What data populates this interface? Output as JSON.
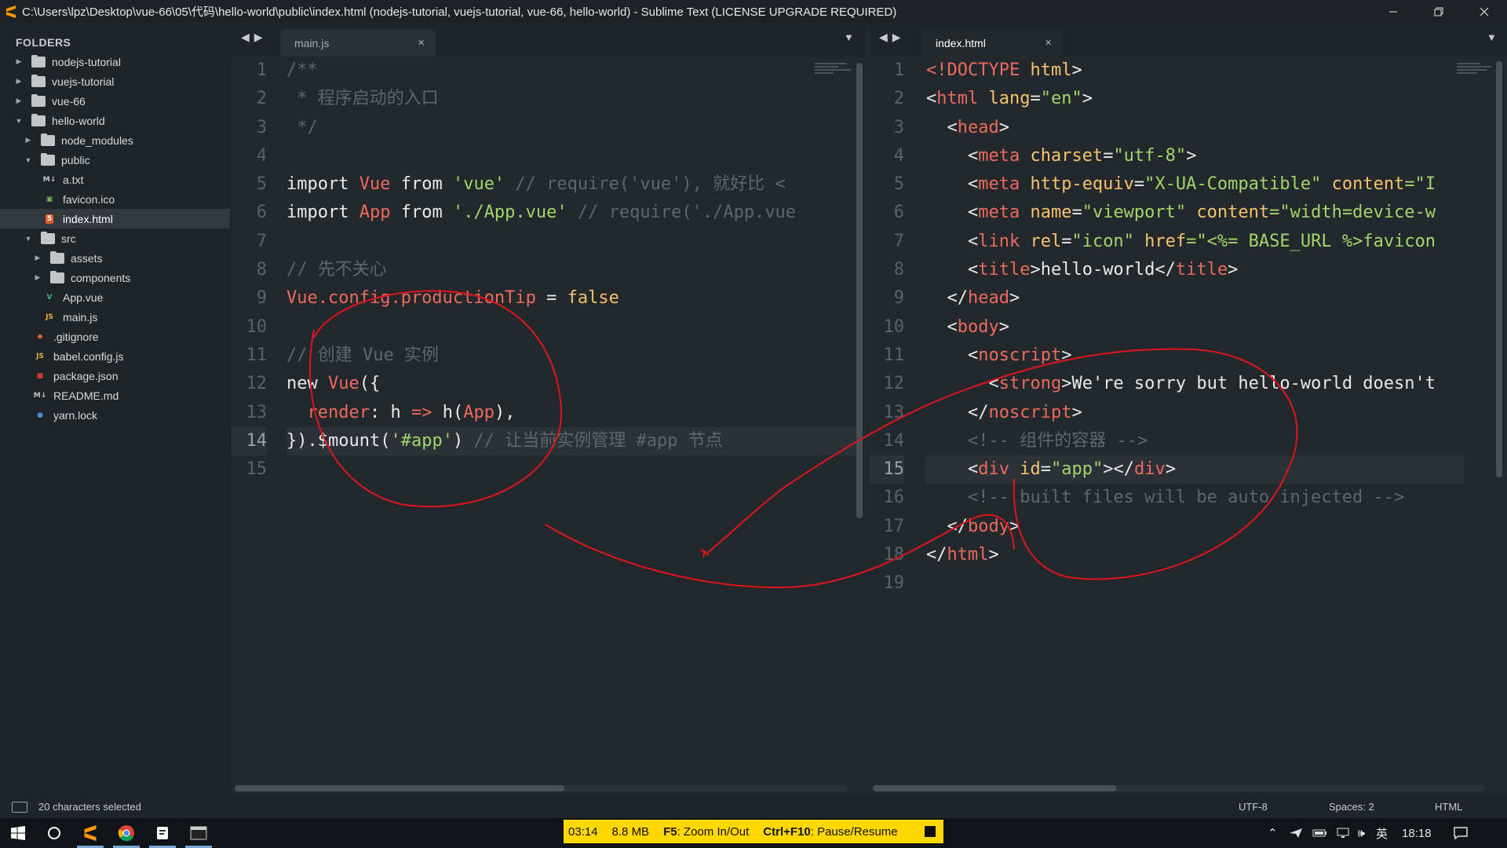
{
  "window": {
    "title": "C:\\Users\\lpz\\Desktop\\vue-66\\05\\代码\\hello-world\\public\\index.html (nodejs-tutorial, vuejs-tutorial, vue-66, hello-world) - Sublime Text (LICENSE UPGRADE REQUIRED)",
    "app_icon": "sublime-text-icon"
  },
  "sidebar": {
    "header": "FOLDERS",
    "items": [
      {
        "label": "nodejs-tutorial",
        "type": "folder",
        "expanded": false
      },
      {
        "label": "vuejs-tutorial",
        "type": "folder",
        "expanded": false
      },
      {
        "label": "vue-66",
        "type": "folder",
        "expanded": false
      },
      {
        "label": "hello-world",
        "type": "folder",
        "expanded": true
      },
      {
        "label": "node_modules",
        "type": "folder",
        "expanded": false
      },
      {
        "label": "public",
        "type": "folder",
        "expanded": true
      },
      {
        "label": "a.txt",
        "type": "md-file-icon"
      },
      {
        "label": "favicon.ico",
        "type": "image-file-icon"
      },
      {
        "label": "index.html",
        "type": "html-file-icon",
        "selected": true
      },
      {
        "label": "src",
        "type": "folder",
        "expanded": true
      },
      {
        "label": "assets",
        "type": "folder",
        "expanded": false
      },
      {
        "label": "components",
        "type": "folder",
        "expanded": false
      },
      {
        "label": "App.vue",
        "type": "vue-file-icon"
      },
      {
        "label": "main.js",
        "type": "js-file-icon"
      },
      {
        "label": ".gitignore",
        "type": "git-file-icon"
      },
      {
        "label": "babel.config.js",
        "type": "js-file-icon"
      },
      {
        "label": "package.json",
        "type": "npm-file-icon"
      },
      {
        "label": "README.md",
        "type": "md-file-icon"
      },
      {
        "label": "yarn.lock",
        "type": "yarn-file-icon"
      }
    ]
  },
  "left_pane": {
    "tab_label": "main.js",
    "close_glyph": "×",
    "line_numbers": [
      "1",
      "2",
      "3",
      "4",
      "5",
      "6",
      "7",
      "8",
      "9",
      "10",
      "11",
      "12",
      "13",
      "14",
      "15"
    ],
    "current_line": 14,
    "lines": [
      [
        {
          "t": "/**",
          "c": "com"
        }
      ],
      [
        {
          "t": " * 程序启动的入口",
          "c": "com"
        }
      ],
      [
        {
          "t": " */",
          "c": "com"
        }
      ],
      [],
      [
        {
          "t": "import ",
          "c": "kw"
        },
        {
          "t": "Vue",
          "c": "red"
        },
        {
          "t": " from ",
          "c": "kw"
        },
        {
          "t": "'vue'",
          "c": "str"
        },
        {
          "t": " // require('vue'), 就好比 <",
          "c": "com"
        }
      ],
      [
        {
          "t": "import ",
          "c": "kw"
        },
        {
          "t": "App",
          "c": "red"
        },
        {
          "t": " from ",
          "c": "kw"
        },
        {
          "t": "'./App.vue'",
          "c": "str"
        },
        {
          "t": " // require('./App.vue",
          "c": "com"
        }
      ],
      [],
      [
        {
          "t": "// 先不关心",
          "c": "com"
        }
      ],
      [
        {
          "t": "Vue.config.productionTip",
          "c": "red"
        },
        {
          "t": " = ",
          "c": "op"
        },
        {
          "t": "false",
          "c": "attr"
        }
      ],
      [],
      [
        {
          "t": "// 创建 Vue 实例",
          "c": "com"
        }
      ],
      [
        {
          "t": "new ",
          "c": "kw"
        },
        {
          "t": "Vue",
          "c": "red"
        },
        {
          "t": "({",
          "c": "op"
        }
      ],
      [
        {
          "t": "  render",
          "c": "red"
        },
        {
          "t": ": h ",
          "c": "op"
        },
        {
          "t": "=>",
          "c": "red"
        },
        {
          "t": " h(",
          "c": "op"
        },
        {
          "t": "App",
          "c": "red"
        },
        {
          "t": "),",
          "c": "op"
        }
      ],
      [
        {
          "t": "}).",
          "c": "op"
        },
        {
          "t": "$mount",
          "c": "kw"
        },
        {
          "t": "(",
          "c": "op"
        },
        {
          "t": "'#app'",
          "c": "str"
        },
        {
          "t": ")",
          "c": "op"
        },
        {
          "t": " // 让当前实例管理 #app 节点",
          "c": "com"
        }
      ],
      []
    ]
  },
  "right_pane": {
    "tab_label": "index.html",
    "close_glyph": "×",
    "line_numbers": [
      "1",
      "2",
      "3",
      "4",
      "5",
      "6",
      "7",
      "8",
      "9",
      "10",
      "11",
      "12",
      "13",
      "14",
      "15",
      "16",
      "17",
      "18",
      "19"
    ],
    "current_line": 15,
    "lines": [
      [
        {
          "t": "<!DOCTYPE",
          "c": "tag"
        },
        {
          "t": " html",
          "c": "attr"
        },
        {
          "t": ">",
          "c": "op"
        }
      ],
      [
        {
          "t": "<",
          "c": "op"
        },
        {
          "t": "html",
          "c": "tag"
        },
        {
          "t": " lang",
          "c": "attr"
        },
        {
          "t": "=",
          "c": "op"
        },
        {
          "t": "\"en\"",
          "c": "val"
        },
        {
          "t": ">",
          "c": "op"
        }
      ],
      [
        {
          "t": "  <",
          "c": "op"
        },
        {
          "t": "head",
          "c": "tag"
        },
        {
          "t": ">",
          "c": "op"
        }
      ],
      [
        {
          "t": "    <",
          "c": "op"
        },
        {
          "t": "meta",
          "c": "tag"
        },
        {
          "t": " charset",
          "c": "attr"
        },
        {
          "t": "=",
          "c": "op"
        },
        {
          "t": "\"utf-8\"",
          "c": "val"
        },
        {
          "t": ">",
          "c": "op"
        }
      ],
      [
        {
          "t": "    <",
          "c": "op"
        },
        {
          "t": "meta",
          "c": "tag"
        },
        {
          "t": " http-equiv",
          "c": "attr"
        },
        {
          "t": "=",
          "c": "op"
        },
        {
          "t": "\"X-UA-Compatible\"",
          "c": "val"
        },
        {
          "t": " content",
          "c": "attr"
        },
        {
          "t": "=\"I",
          "c": "val"
        }
      ],
      [
        {
          "t": "    <",
          "c": "op"
        },
        {
          "t": "meta",
          "c": "tag"
        },
        {
          "t": " name",
          "c": "attr"
        },
        {
          "t": "=",
          "c": "op"
        },
        {
          "t": "\"viewport\"",
          "c": "val"
        },
        {
          "t": " content",
          "c": "attr"
        },
        {
          "t": "=\"width=device-w",
          "c": "val"
        }
      ],
      [
        {
          "t": "    <",
          "c": "op"
        },
        {
          "t": "link",
          "c": "tag"
        },
        {
          "t": " rel",
          "c": "attr"
        },
        {
          "t": "=",
          "c": "op"
        },
        {
          "t": "\"icon\"",
          "c": "val"
        },
        {
          "t": " href",
          "c": "attr"
        },
        {
          "t": "=\"<%= BASE_URL %>favicon",
          "c": "val"
        }
      ],
      [
        {
          "t": "    <",
          "c": "op"
        },
        {
          "t": "title",
          "c": "tag"
        },
        {
          "t": ">hello-world</",
          "c": "op"
        },
        {
          "t": "title",
          "c": "tag"
        },
        {
          "t": ">",
          "c": "op"
        }
      ],
      [
        {
          "t": "  </",
          "c": "op"
        },
        {
          "t": "head",
          "c": "tag"
        },
        {
          "t": ">",
          "c": "op"
        }
      ],
      [
        {
          "t": "  <",
          "c": "op"
        },
        {
          "t": "body",
          "c": "tag"
        },
        {
          "t": ">",
          "c": "op"
        }
      ],
      [
        {
          "t": "    <",
          "c": "op"
        },
        {
          "t": "noscript",
          "c": "tag"
        },
        {
          "t": ">",
          "c": "op"
        }
      ],
      [
        {
          "t": "      <",
          "c": "op"
        },
        {
          "t": "strong",
          "c": "tag"
        },
        {
          "t": ">We're sorry but hello-world doesn't",
          "c": "op"
        }
      ],
      [
        {
          "t": "    </",
          "c": "op"
        },
        {
          "t": "noscript",
          "c": "tag"
        },
        {
          "t": ">",
          "c": "op"
        }
      ],
      [
        {
          "t": "    <!-- 组件的容器 -->",
          "c": "com"
        }
      ],
      [
        {
          "t": "    <",
          "c": "op"
        },
        {
          "t": "div",
          "c": "tag"
        },
        {
          "t": " id",
          "c": "attr"
        },
        {
          "t": "=",
          "c": "op"
        },
        {
          "t": "\"app\"",
          "c": "val"
        },
        {
          "t": "></",
          "c": "op"
        },
        {
          "t": "div",
          "c": "tag"
        },
        {
          "t": ">",
          "c": "op"
        }
      ],
      [
        {
          "t": "    <!-- built files will be auto injected -->",
          "c": "com"
        }
      ],
      [
        {
          "t": "  </",
          "c": "op"
        },
        {
          "t": "body",
          "c": "tag"
        },
        {
          "t": ">",
          "c": "op"
        }
      ],
      [
        {
          "t": "</",
          "c": "op"
        },
        {
          "t": "html",
          "c": "tag"
        },
        {
          "t": ">",
          "c": "op"
        }
      ],
      []
    ]
  },
  "statusbar": {
    "selection": "20 characters selected",
    "encoding": "UTF-8",
    "indent": "Spaces: 2",
    "syntax": "HTML"
  },
  "recorder": {
    "time": "03:14",
    "size": "8.8 MB",
    "zoom_key": "F5",
    "zoom_label": ": Zoom In/Out",
    "pause_key": "Ctrl+F10",
    "pause_label": ": Pause/Resume"
  },
  "taskbar": {
    "ime": "英",
    "clock": "18:18",
    "apps": [
      "windows-start-icon",
      "cortana-search-icon",
      "sublime-text-icon",
      "chrome-icon",
      "notes-app-icon",
      "terminal-icon"
    ]
  },
  "colors": {
    "editor_bg": "#23282d",
    "sidebar_bg": "#1f2428",
    "annotation": "#e0151b",
    "recorder": "#ffd800"
  }
}
